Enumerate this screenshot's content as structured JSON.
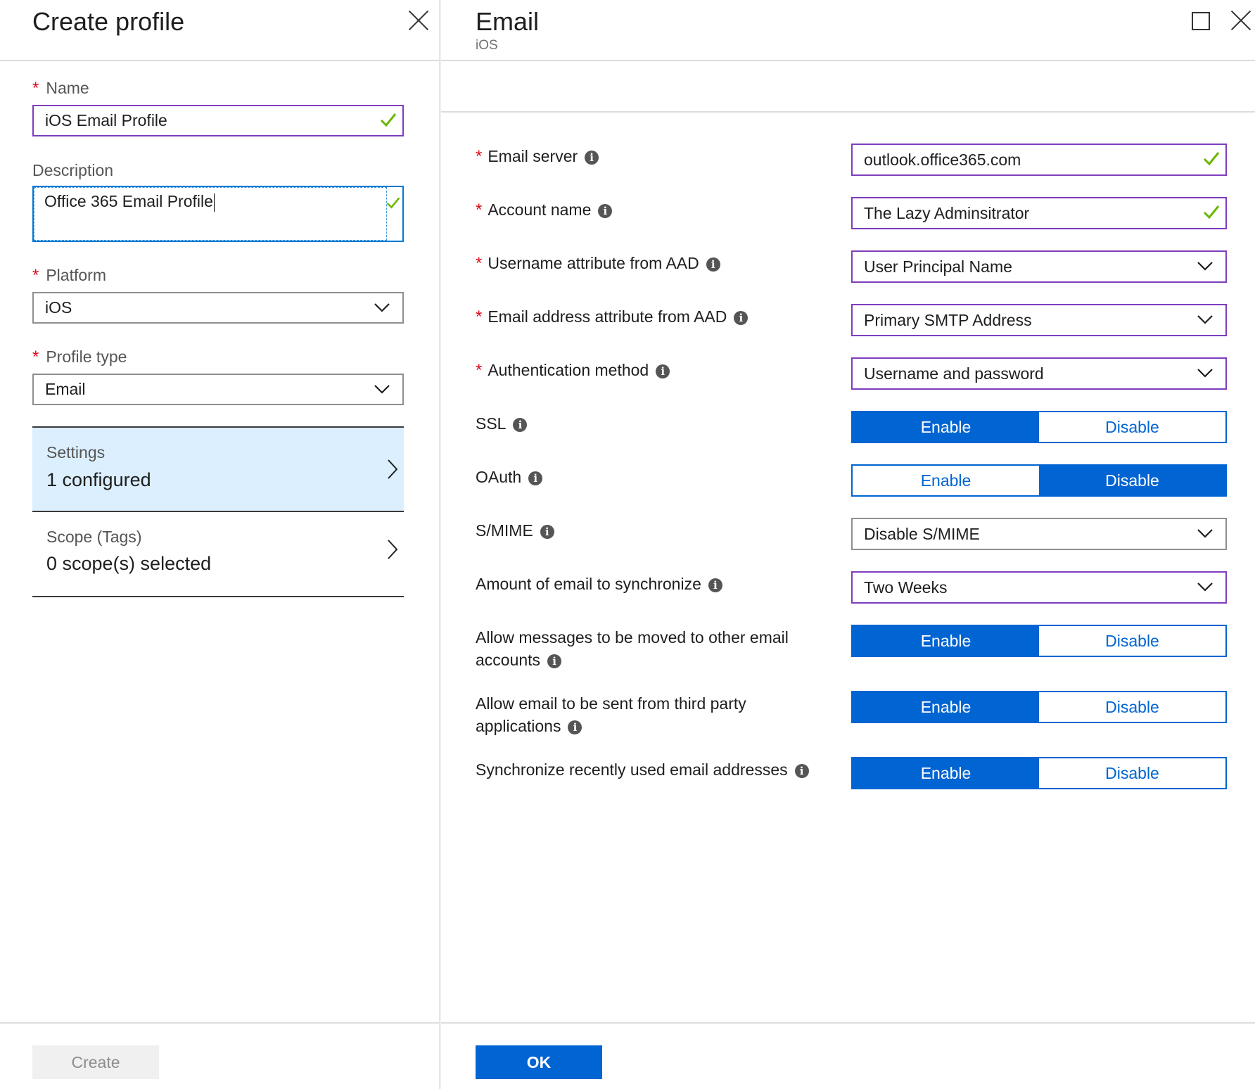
{
  "left_blade": {
    "title": "Create profile",
    "name": {
      "label": "Name",
      "required_mark": "*",
      "value": "iOS Email Profile"
    },
    "description": {
      "label": "Description",
      "value": "Office 365 Email Profile"
    },
    "platform": {
      "label": "Platform",
      "required_mark": "*",
      "value": "iOS"
    },
    "profile_type": {
      "label": "Profile type",
      "required_mark": "*",
      "value": "Email"
    },
    "settings": {
      "label": "Settings",
      "value": "1 configured"
    },
    "scope": {
      "label": "Scope (Tags)",
      "value": "0 scope(s) selected"
    },
    "create_label": "Create"
  },
  "right_blade": {
    "title": "Email",
    "subtitle": "iOS",
    "ok_label": "OK",
    "fields": {
      "email_server": {
        "label": "Email server",
        "required_mark": "*",
        "value": "outlook.office365.com"
      },
      "account_name": {
        "label": "Account name",
        "required_mark": "*",
        "value": "The Lazy Adminsitrator"
      },
      "username_attr": {
        "label": "Username attribute from AAD",
        "required_mark": "*",
        "value": "User Principal Name"
      },
      "email_attr": {
        "label": "Email address attribute from AAD",
        "required_mark": "*",
        "value": "Primary SMTP Address"
      },
      "auth_method": {
        "label": "Authentication method",
        "required_mark": "*",
        "value": "Username and password"
      },
      "ssl": {
        "label": "SSL",
        "selected": "Enable"
      },
      "oauth": {
        "label": "OAuth",
        "selected": "Disable"
      },
      "smime": {
        "label": "S/MIME",
        "value": "Disable S/MIME"
      },
      "sync_amount": {
        "label": "Amount of email to synchronize",
        "value": "Two Weeks"
      },
      "allow_move_line1": "Allow messages to be moved to other email",
      "allow_move_line2": "accounts",
      "allow_move_selected": "Enable",
      "third_party_line1": "Allow email to be sent from third party",
      "third_party_line2": "applications",
      "third_party_selected": "Enable",
      "sync_recent": {
        "label": "Synchronize recently used email addresses",
        "selected": "Enable"
      }
    },
    "toggle_labels": {
      "enable": "Enable",
      "disable": "Disable"
    }
  },
  "icons": [
    "close-icon",
    "maximize-icon",
    "check-icon",
    "chevron-down-icon",
    "chevron-right-icon",
    "info-icon"
  ],
  "colors": {
    "accent": "#0064d2",
    "valid_border": "#7f3dbe",
    "required": "#e00b1c",
    "check": "#6bb700",
    "selected_row": "#dcefff"
  }
}
